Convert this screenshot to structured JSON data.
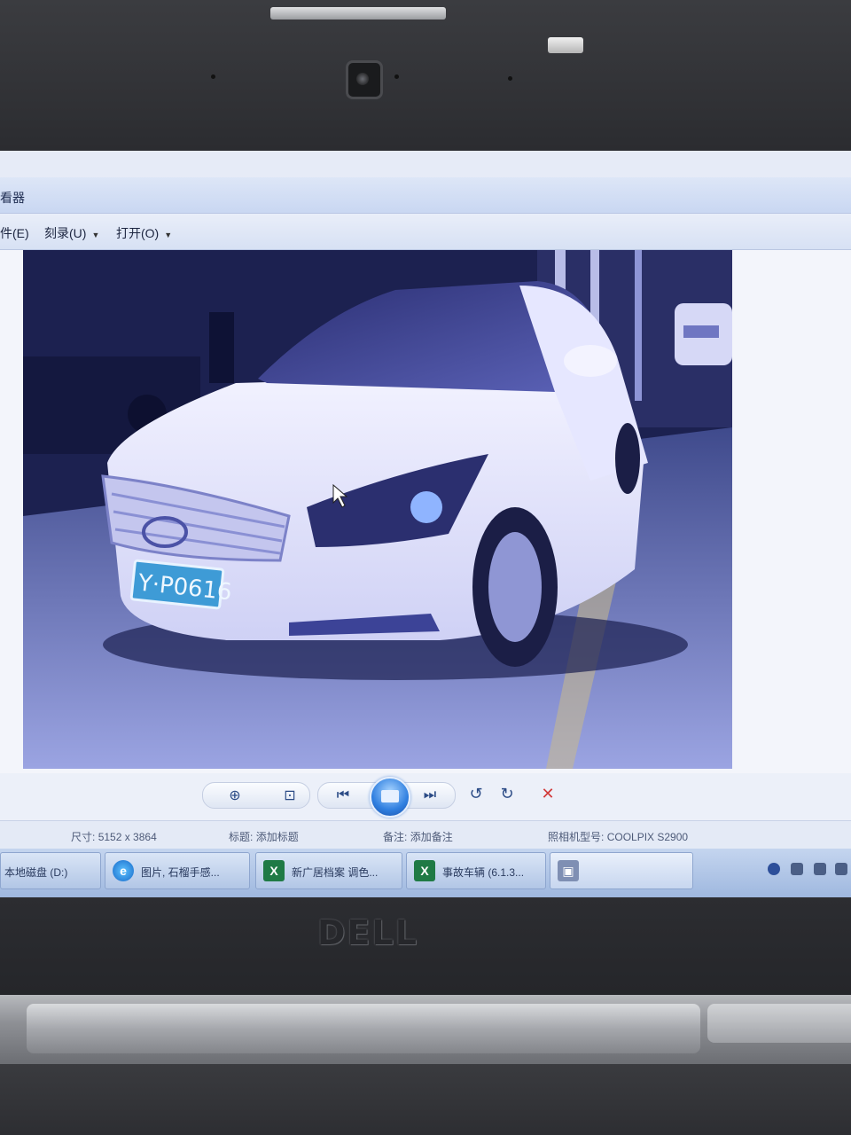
{
  "window": {
    "title": "看器"
  },
  "menu": [
    {
      "label": "件(E)",
      "has_arrow": false
    },
    {
      "label": "刻录(U)",
      "has_arrow": true
    },
    {
      "label": "打开(O)",
      "has_arrow": true
    }
  ],
  "photo": {
    "plate_text": "Y·P0616"
  },
  "toolbar": {
    "zoom_icon": "zoom-icon",
    "actual_size_icon": "actual-size-icon",
    "previous_icon": "previous-icon",
    "slideshow_icon": "slideshow-icon",
    "next_icon": "next-icon",
    "rotate_left_icon": "rotate-ccw-icon",
    "rotate_right_icon": "rotate-cw-icon",
    "delete_icon": "delete-icon"
  },
  "status": {
    "size_label": "尺寸:",
    "size_value": "5152 x 3864",
    "title_label": "标题:",
    "title_value": "添加标题",
    "notes_label": "备注:",
    "notes_value": "添加备注",
    "camera_label": "照相机型号:",
    "camera_value": "COOLPIX S2900"
  },
  "taskbar": {
    "items": [
      {
        "label": "本地磁盘 (D:)"
      },
      {
        "label": "图片, 石榴手感..."
      },
      {
        "label": "新广居档案 调色..."
      },
      {
        "label": "事故车辆 (6.1.3..."
      },
      {
        "label": ""
      }
    ]
  },
  "brand": {
    "logo": "DELL"
  },
  "colors": {
    "screen_bg": "#e6ebf7",
    "photo_bg": "#1f2553",
    "plate": "#3e9bd6",
    "accent": "#2f7fe0"
  }
}
